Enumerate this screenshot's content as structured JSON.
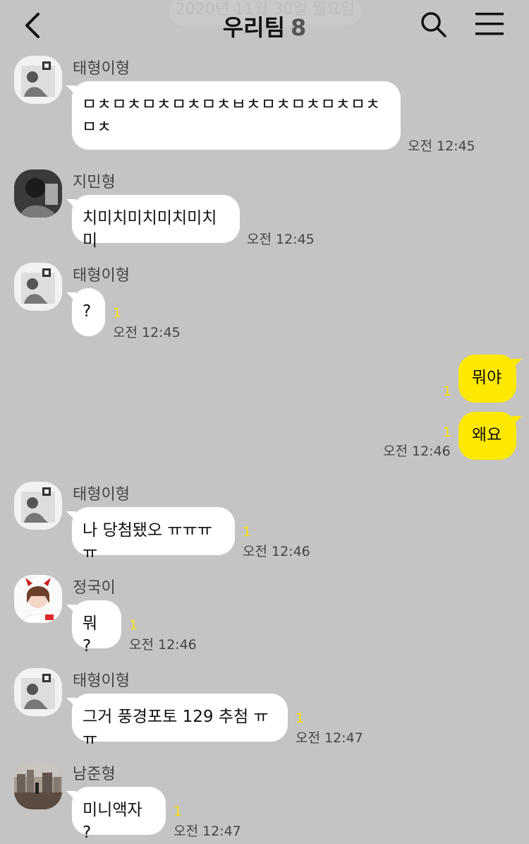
{
  "header": {
    "date_banner": "2020년 11월 30일 월요일",
    "title": "우리팀",
    "member_count": "8"
  },
  "messages": [
    {
      "sender": "태형이형",
      "text": "ㅁㅊㅁㅊㅁㅊㅁㅊㅁㅊㅂㅊㅁㅊㅁㅊㅁㅊㅁㅊㅁㅊ",
      "unread": "",
      "time": "오전 12:45"
    },
    {
      "sender": "지민형",
      "text": "치미치미치미치미치미",
      "unread": "",
      "time": "오전 12:45"
    },
    {
      "sender": "태형이형",
      "text": "?",
      "unread": "1",
      "time": "오전 12:45"
    },
    {
      "sender": "",
      "text": "뭐야",
      "unread": "1",
      "time": ""
    },
    {
      "sender": "",
      "text": "왜요",
      "unread": "1",
      "time": "오전 12:46"
    },
    {
      "sender": "태형이형",
      "text": "나 당첨됐오 ㅠㅠㅠㅠ",
      "unread": "1",
      "time": "오전 12:46"
    },
    {
      "sender": "정국이",
      "text": "뭐 ?",
      "unread": "1",
      "time": "오전 12:46"
    },
    {
      "sender": "태형이형",
      "text": "그거 풍경포토 129 추첨 ㅠㅠ",
      "unread": "1",
      "time": "오전 12:47"
    },
    {
      "sender": "남준형",
      "text": "미니액자 ?",
      "unread": "1",
      "time": "오전 12:47"
    }
  ]
}
